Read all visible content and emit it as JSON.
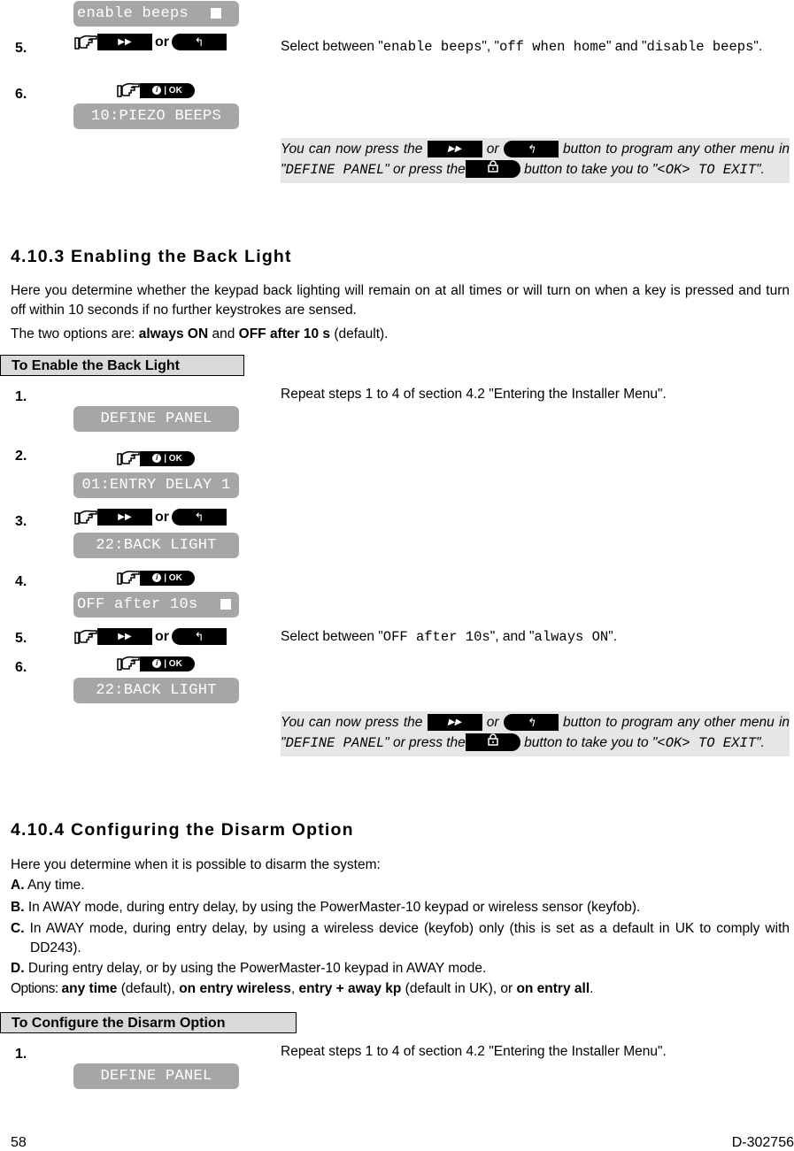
{
  "section_prev": {
    "lcd_top": {
      "text": "enable beeps",
      "checked_marker": true
    },
    "steps": [
      {
        "num": "5.",
        "keys": [
          "next-key",
          "or",
          "back-key"
        ],
        "or_label": "or",
        "description": {
          "prefix": "Select between \"",
          "opt1": "enable beeps",
          "mid1": "\", \"",
          "opt2": "off when home",
          "mid2": "\" and \"",
          "opt3": "disable beeps",
          "suffix": "\"."
        }
      },
      {
        "num": "6.",
        "keys": [
          "ok-key"
        ],
        "lcd": "10:PIEZO BEEPS"
      }
    ],
    "note": {
      "t1": "You can now press the",
      "t2": "or",
      "t3": "button to program any other menu in \"",
      "menu": "DEFINE PANEL",
      "t4": "\" or press the",
      "t5": "button to take you to \"",
      "exit": "<OK> TO EXIT",
      "t6": "\"."
    }
  },
  "section_backlight": {
    "heading": "4.10.3 Enabling the Back Light",
    "intro": "Here you determine whether the keypad back lighting will remain on at all times or will turn on when a key is pressed and turn off within 10 seconds if no further keystrokes are sensed.",
    "options_prefix": "The two options are: ",
    "option1": "always ON",
    "options_and": " and ",
    "option2": "OFF after 10 s",
    "options_suffix": " (default).",
    "box_title": "To Enable the Back Light",
    "steps": [
      {
        "num": "1.",
        "lcd": "DEFINE PANEL",
        "description": "Repeat steps 1 to 4 of section 4.2 \"Entering the Installer Menu\"."
      },
      {
        "num": "2.",
        "lcd": "01:ENTRY DELAY 1"
      },
      {
        "num": "3.",
        "lcd": "22:BACK LIGHT",
        "or_label": "or"
      },
      {
        "num": "4.",
        "lcd": "OFF after 10s",
        "checked_marker": true
      },
      {
        "num": "5.",
        "or_label": "or",
        "description": {
          "prefix": "Select between \"",
          "opt1": "OFF after 10s",
          "mid": "\", and \"",
          "opt2": "always ON",
          "suffix": "\"."
        }
      },
      {
        "num": "6.",
        "lcd": "22:BACK LIGHT"
      }
    ],
    "note": {
      "t1": "You can now press the",
      "t2": "or",
      "t3": "button to program any other menu in \"",
      "menu": "DEFINE PANEL",
      "t4": "\" or press the",
      "t5": "button to take you to \"",
      "exit": "<OK> TO EXIT",
      "t6": "\"."
    }
  },
  "section_disarm": {
    "heading": "4.10.4 Configuring the Disarm Option",
    "intro": "Here you determine when it is possible to disarm the system:",
    "items": [
      {
        "label": "A.",
        "text": " Any time."
      },
      {
        "label": "B.",
        "text": "In AWAY mode, during entry delay, by using the PowerMaster-10 keypad or wireless sensor (keyfob)."
      },
      {
        "label": "C.",
        "text": "In AWAY mode, during entry delay, by using a wireless device (keyfob) only (this is set as a default in UK to comply with DD243)."
      },
      {
        "label": "D.",
        "text": "During entry delay, or by using the PowerMaster-10 keypad in AWAY mode."
      }
    ],
    "options": {
      "prefix": "Options: ",
      "o1": "any time",
      "s1": " (default), ",
      "o2": "on entry wireless",
      "s2": ", ",
      "o3": "entry + away kp",
      "s3": " (default in UK), or ",
      "o4": "on entry all",
      "s4": "."
    },
    "box_title": "To Configure the Disarm Option",
    "steps": [
      {
        "num": "1.",
        "lcd": "DEFINE PANEL",
        "description": "Repeat steps 1 to 4 of section 4.2 \"Entering the Installer Menu\"."
      }
    ]
  },
  "footer": {
    "page_number": "58",
    "doc_id": "D-302756"
  },
  "keys": {
    "next_glyph": "▶▶",
    "back_glyph": "↰",
    "ok_info": "i",
    "ok_label": "OK",
    "ok_sep": "|"
  }
}
